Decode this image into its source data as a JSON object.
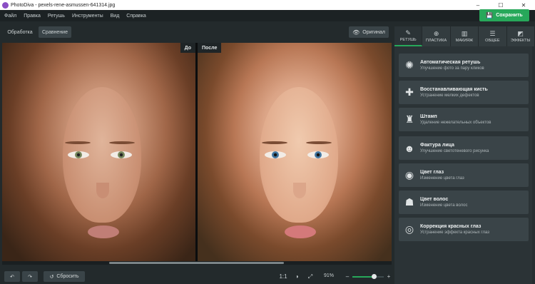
{
  "window": {
    "app_title": "PhotoDiva - pexels-rene-asmussen-641314.jpg",
    "controls": {
      "minimize": "–",
      "maximize": "☐",
      "close": "✕"
    }
  },
  "menu": [
    "Файл",
    "Правка",
    "Ретушь",
    "Инструменты",
    "Вид",
    "Справка"
  ],
  "save_button": {
    "label": "Сохранить",
    "icon": "save-icon"
  },
  "toolbar": {
    "modes": [
      "Обработка",
      "Сравнение"
    ],
    "active_mode": "Сравнение",
    "original_button": "Оригинал"
  },
  "compare": {
    "before_label": "До",
    "after_label": "После"
  },
  "bottom": {
    "reset_label": "Сбросить",
    "ratio_label": "1:1",
    "zoom_text": "91%",
    "zoom_level": 0.68,
    "zoom_minus": "–",
    "zoom_plus": "+"
  },
  "tabs": [
    {
      "label": "РЕТУШЬ",
      "icon": "retouch-icon",
      "active": true
    },
    {
      "label": "ПЛАСТИКА",
      "icon": "plastic-icon",
      "active": false
    },
    {
      "label": "МАКИЯЖ",
      "icon": "makeup-icon",
      "active": false
    },
    {
      "label": "ОБЩЕЕ",
      "icon": "sliders-icon",
      "active": false
    },
    {
      "label": "ЭФФЕКТЫ",
      "icon": "effects-icon",
      "active": false
    }
  ],
  "tools": [
    {
      "name": "Автоматическая ретушь",
      "desc": "Улучшение фото за пару кликов",
      "icon": "auto-retouch-icon"
    },
    {
      "name": "Восстанавливающая кисть",
      "desc": "Устранение мелких дефектов",
      "icon": "healing-brush-icon"
    },
    {
      "name": "Штамп",
      "desc": "Удаление нежелательных объектов",
      "icon": "stamp-icon"
    },
    {
      "name": "Фактура лица",
      "desc": "Улучшение светотеневого рисунка",
      "icon": "face-texture-icon"
    },
    {
      "name": "Цвет глаз",
      "desc": "Изменение цвета глаз",
      "icon": "eye-color-icon"
    },
    {
      "name": "Цвет волос",
      "desc": "Изменение цвета волос",
      "icon": "hair-color-icon"
    },
    {
      "name": "Коррекция красных глаз",
      "desc": "Устранение эффекта красных глаз",
      "icon": "red-eye-icon"
    }
  ],
  "colors": {
    "accent": "#27a85a",
    "background": "#232a2c",
    "panel": "#2b3336",
    "button": "#3a4448"
  }
}
